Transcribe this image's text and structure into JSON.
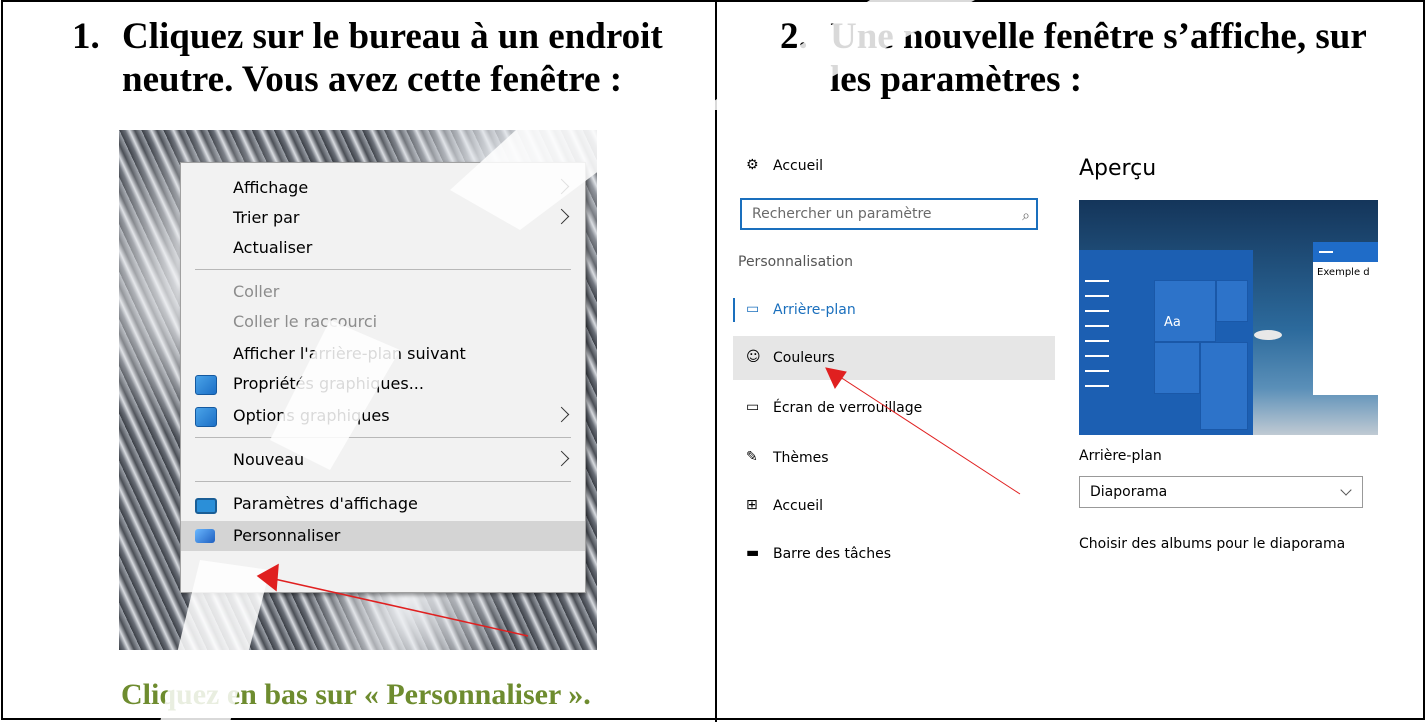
{
  "steps": [
    {
      "number": "1.",
      "text": "Cliquez sur le bureau à un endroit neutre. Vous avez cette fenêtre :"
    },
    {
      "number": "2.",
      "text": "Une nouvelle fenêtre s’affiche, sur les paramètres :"
    }
  ],
  "context_menu": {
    "items": [
      {
        "label": "Affichage",
        "submenu": true,
        "disabled": false
      },
      {
        "label": "Trier par",
        "submenu": true,
        "disabled": false
      },
      {
        "label": "Actualiser",
        "submenu": false,
        "disabled": false
      },
      {
        "label": "Coller",
        "submenu": false,
        "disabled": true
      },
      {
        "label": "Coller le raccourci",
        "submenu": false,
        "disabled": true
      },
      {
        "label": "Afficher l'arrière-plan suivant",
        "submenu": false,
        "disabled": false
      },
      {
        "label": "Propriétés graphiques...",
        "submenu": false,
        "disabled": false,
        "icon": "graphics-icon"
      },
      {
        "label": "Options graphiques",
        "submenu": true,
        "disabled": false,
        "icon": "graphics-icon"
      },
      {
        "label": "Nouveau",
        "submenu": true,
        "disabled": false
      },
      {
        "label": "Paramètres d'affichage",
        "submenu": false,
        "disabled": false,
        "icon": "display-icon"
      },
      {
        "label": "Personnaliser",
        "submenu": false,
        "disabled": false,
        "icon": "personalize-icon",
        "highlighted": true
      }
    ]
  },
  "caption1": "Cliquez en bas sur « Personnaliser ».",
  "settings": {
    "home_label": "Accueil",
    "search_placeholder": "Rechercher un paramètre",
    "section": "Personnalisation",
    "nav": [
      {
        "label": "Arrière-plan",
        "icon": "picture-icon",
        "selected": true
      },
      {
        "label": "Couleurs",
        "icon": "palette-icon",
        "hover": true
      },
      {
        "label": "Écran de verrouillage",
        "icon": "lock-screen-icon"
      },
      {
        "label": "Thèmes",
        "icon": "brush-icon"
      },
      {
        "label": "Accueil",
        "icon": "start-icon"
      },
      {
        "label": "Barre des tâches",
        "icon": "taskbar-icon"
      }
    ],
    "preview_title": "Aperçu",
    "preview_sample": "Aa",
    "preview_window_text": "Exemple d",
    "background_label": "Arrière-plan",
    "background_value": "Diaporama",
    "albums_text": "Choisir des albums pour le diaporama"
  },
  "colors": {
    "accent": "#1a6fbd",
    "caption": "#6e8c2f",
    "arrow": "#e02020"
  }
}
